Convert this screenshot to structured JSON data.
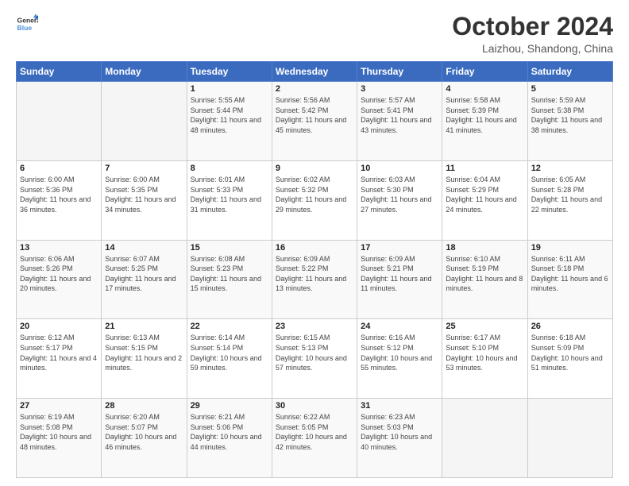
{
  "logo": {
    "line1": "General",
    "line2": "Blue",
    "icon_color": "#4a90d9"
  },
  "header": {
    "title": "October 2024",
    "location": "Laizhou, Shandong, China"
  },
  "days_of_week": [
    "Sunday",
    "Monday",
    "Tuesday",
    "Wednesday",
    "Thursday",
    "Friday",
    "Saturday"
  ],
  "weeks": [
    [
      {
        "day": "",
        "content": ""
      },
      {
        "day": "",
        "content": ""
      },
      {
        "day": "1",
        "content": "Sunrise: 5:55 AM\nSunset: 5:44 PM\nDaylight: 11 hours and 48 minutes."
      },
      {
        "day": "2",
        "content": "Sunrise: 5:56 AM\nSunset: 5:42 PM\nDaylight: 11 hours and 45 minutes."
      },
      {
        "day": "3",
        "content": "Sunrise: 5:57 AM\nSunset: 5:41 PM\nDaylight: 11 hours and 43 minutes."
      },
      {
        "day": "4",
        "content": "Sunrise: 5:58 AM\nSunset: 5:39 PM\nDaylight: 11 hours and 41 minutes."
      },
      {
        "day": "5",
        "content": "Sunrise: 5:59 AM\nSunset: 5:38 PM\nDaylight: 11 hours and 38 minutes."
      }
    ],
    [
      {
        "day": "6",
        "content": "Sunrise: 6:00 AM\nSunset: 5:36 PM\nDaylight: 11 hours and 36 minutes."
      },
      {
        "day": "7",
        "content": "Sunrise: 6:00 AM\nSunset: 5:35 PM\nDaylight: 11 hours and 34 minutes."
      },
      {
        "day": "8",
        "content": "Sunrise: 6:01 AM\nSunset: 5:33 PM\nDaylight: 11 hours and 31 minutes."
      },
      {
        "day": "9",
        "content": "Sunrise: 6:02 AM\nSunset: 5:32 PM\nDaylight: 11 hours and 29 minutes."
      },
      {
        "day": "10",
        "content": "Sunrise: 6:03 AM\nSunset: 5:30 PM\nDaylight: 11 hours and 27 minutes."
      },
      {
        "day": "11",
        "content": "Sunrise: 6:04 AM\nSunset: 5:29 PM\nDaylight: 11 hours and 24 minutes."
      },
      {
        "day": "12",
        "content": "Sunrise: 6:05 AM\nSunset: 5:28 PM\nDaylight: 11 hours and 22 minutes."
      }
    ],
    [
      {
        "day": "13",
        "content": "Sunrise: 6:06 AM\nSunset: 5:26 PM\nDaylight: 11 hours and 20 minutes."
      },
      {
        "day": "14",
        "content": "Sunrise: 6:07 AM\nSunset: 5:25 PM\nDaylight: 11 hours and 17 minutes."
      },
      {
        "day": "15",
        "content": "Sunrise: 6:08 AM\nSunset: 5:23 PM\nDaylight: 11 hours and 15 minutes."
      },
      {
        "day": "16",
        "content": "Sunrise: 6:09 AM\nSunset: 5:22 PM\nDaylight: 11 hours and 13 minutes."
      },
      {
        "day": "17",
        "content": "Sunrise: 6:09 AM\nSunset: 5:21 PM\nDaylight: 11 hours and 11 minutes."
      },
      {
        "day": "18",
        "content": "Sunrise: 6:10 AM\nSunset: 5:19 PM\nDaylight: 11 hours and 8 minutes."
      },
      {
        "day": "19",
        "content": "Sunrise: 6:11 AM\nSunset: 5:18 PM\nDaylight: 11 hours and 6 minutes."
      }
    ],
    [
      {
        "day": "20",
        "content": "Sunrise: 6:12 AM\nSunset: 5:17 PM\nDaylight: 11 hours and 4 minutes."
      },
      {
        "day": "21",
        "content": "Sunrise: 6:13 AM\nSunset: 5:15 PM\nDaylight: 11 hours and 2 minutes."
      },
      {
        "day": "22",
        "content": "Sunrise: 6:14 AM\nSunset: 5:14 PM\nDaylight: 10 hours and 59 minutes."
      },
      {
        "day": "23",
        "content": "Sunrise: 6:15 AM\nSunset: 5:13 PM\nDaylight: 10 hours and 57 minutes."
      },
      {
        "day": "24",
        "content": "Sunrise: 6:16 AM\nSunset: 5:12 PM\nDaylight: 10 hours and 55 minutes."
      },
      {
        "day": "25",
        "content": "Sunrise: 6:17 AM\nSunset: 5:10 PM\nDaylight: 10 hours and 53 minutes."
      },
      {
        "day": "26",
        "content": "Sunrise: 6:18 AM\nSunset: 5:09 PM\nDaylight: 10 hours and 51 minutes."
      }
    ],
    [
      {
        "day": "27",
        "content": "Sunrise: 6:19 AM\nSunset: 5:08 PM\nDaylight: 10 hours and 48 minutes."
      },
      {
        "day": "28",
        "content": "Sunrise: 6:20 AM\nSunset: 5:07 PM\nDaylight: 10 hours and 46 minutes."
      },
      {
        "day": "29",
        "content": "Sunrise: 6:21 AM\nSunset: 5:06 PM\nDaylight: 10 hours and 44 minutes."
      },
      {
        "day": "30",
        "content": "Sunrise: 6:22 AM\nSunset: 5:05 PM\nDaylight: 10 hours and 42 minutes."
      },
      {
        "day": "31",
        "content": "Sunrise: 6:23 AM\nSunset: 5:03 PM\nDaylight: 10 hours and 40 minutes."
      },
      {
        "day": "",
        "content": ""
      },
      {
        "day": "",
        "content": ""
      }
    ]
  ]
}
